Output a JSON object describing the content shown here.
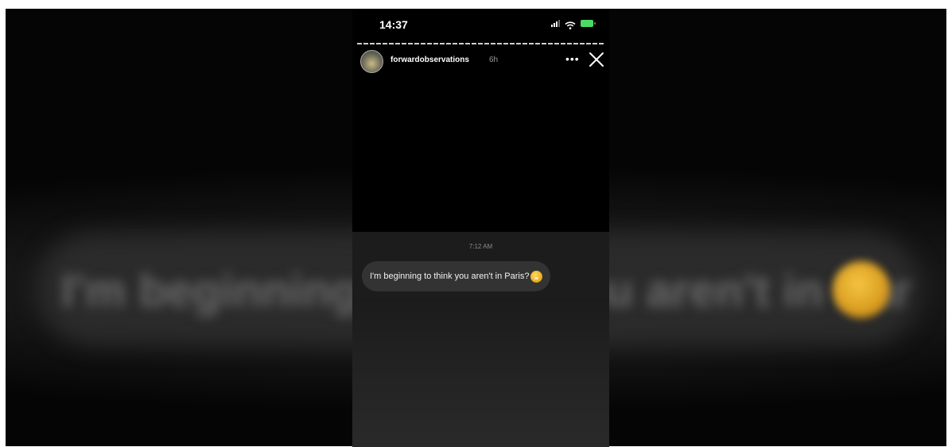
{
  "status_bar": {
    "time": "14:37",
    "icons": [
      "cellular-signal-icon",
      "wifi-icon",
      "battery-charging-icon"
    ],
    "battery_color": "#4cd964"
  },
  "story": {
    "username": "forwardobservations",
    "time_ago": "6h",
    "more_icon": "more-dots-icon",
    "more_symbol": "•••",
    "close_icon": "close-icon"
  },
  "message": {
    "timestamp": "7:12 AM",
    "text": "I'm beginning to think you aren't in Paris?",
    "emoji_icon": "thinking-face-icon"
  },
  "background": {
    "blurred_text": "I'm beginning to think you aren't in Paris?"
  }
}
